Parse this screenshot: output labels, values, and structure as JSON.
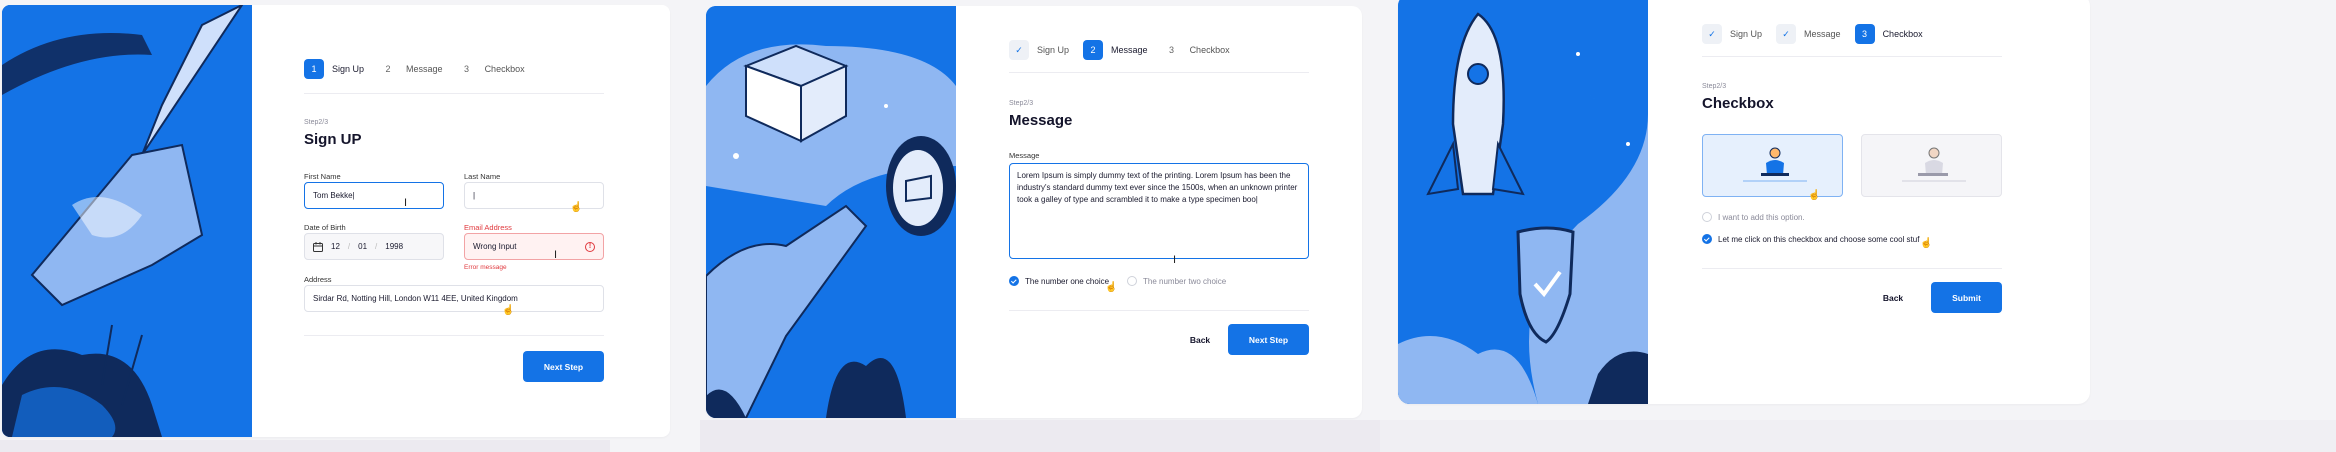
{
  "colors": {
    "accent": "#1473e6",
    "error": "#e0393e",
    "illustration_bg": "#1473e6"
  },
  "panel1": {
    "steps": [
      {
        "num": "1",
        "label": "Sign Up",
        "state": "active"
      },
      {
        "num": "2",
        "label": "Message",
        "state": "upcoming"
      },
      {
        "num": "3",
        "label": "Checkbox",
        "state": "upcoming"
      }
    ],
    "step_indicator": "Step2/3",
    "title": "Sign UP",
    "first_name": {
      "label": "First Name",
      "value": "Tom Bekke"
    },
    "last_name": {
      "label": "Last Name",
      "value": ""
    },
    "dob": {
      "label": "Date of Birth",
      "day": "12",
      "month": "01",
      "year": "1998"
    },
    "email": {
      "label": "Email Address",
      "value": "Wrong Input",
      "error": "Error message"
    },
    "address": {
      "label": "Address",
      "value": "Sirdar Rd, Notting Hill, London W11 4EE, United Kingdom"
    },
    "next_button": "Next Step"
  },
  "panel2": {
    "steps": [
      {
        "num": "✓",
        "label": "Sign Up",
        "state": "done"
      },
      {
        "num": "2",
        "label": "Message",
        "state": "active"
      },
      {
        "num": "3",
        "label": "Checkbox",
        "state": "upcoming"
      }
    ],
    "step_indicator": "Step2/3",
    "title": "Message",
    "message_label": "Message",
    "message_value": "Lorem Ipsum is simply dummy text of the printing. Lorem Ipsum has been the industry's standard dummy text ever since the 1500s, when an unknown printer took a galley of type and scrambled it to make a type specimen boo|",
    "choice1": "The number one choice",
    "choice2": "The number two choice",
    "back_button": "Back",
    "next_button": "Next Step"
  },
  "panel3": {
    "steps": [
      {
        "num": "✓",
        "label": "Sign Up",
        "state": "done"
      },
      {
        "num": "✓",
        "label": "Message",
        "state": "done"
      },
      {
        "num": "3",
        "label": "Checkbox",
        "state": "active"
      }
    ],
    "step_indicator": "Step2/3",
    "title": "Checkbox",
    "option1": "I want to add this option.",
    "option2": "Let me click on this checkbox and choose some cool stuf",
    "back_button": "Back",
    "submit_button": "Submit"
  }
}
